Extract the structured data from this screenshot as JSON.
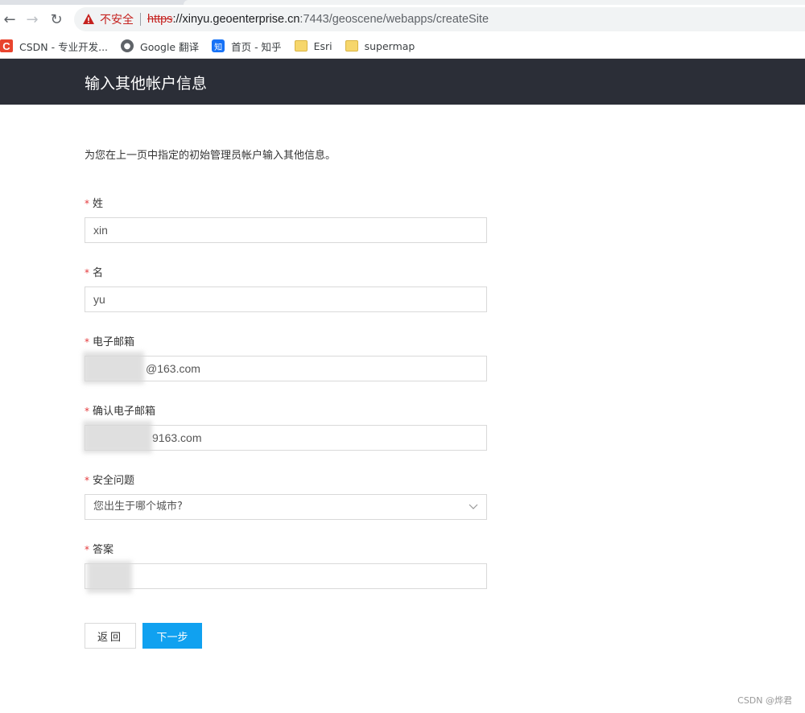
{
  "browser": {
    "insecure_label": "不安全",
    "url_scheme": "https",
    "url_host": "://xinyu.geoenterprise.cn",
    "url_rest": ":7443/geoscene/webapps/createSite",
    "bookmarks": [
      {
        "label": "CSDN - 专业开发...",
        "icon": "C"
      },
      {
        "label": "Google 翻译",
        "icon": "globe-icon"
      },
      {
        "label": "首页 - 知乎",
        "icon": "知"
      },
      {
        "label": "Esri",
        "icon": "folder-icon"
      },
      {
        "label": "supermap",
        "icon": "folder-icon"
      }
    ]
  },
  "header": {
    "title": "输入其他帐户信息"
  },
  "form": {
    "intro": "为您在上一页中指定的初始管理员帐户输入其他信息。",
    "required_mark": "*",
    "fields": [
      {
        "label": "姓",
        "value": "xin"
      },
      {
        "label": "名",
        "value": "yu"
      },
      {
        "label": "电子邮箱",
        "value": "@163.com"
      },
      {
        "label": "确认电子邮箱",
        "value": "9163.com"
      },
      {
        "label": "安全问题",
        "value": "您出生于哪个城市?"
      },
      {
        "label": "答案",
        "value": ""
      }
    ]
  },
  "buttons": {
    "back": "返回",
    "next": "下一步"
  },
  "watermark": "CSDN @烨君",
  "colors": {
    "header_bg": "#2b2e37",
    "primary": "#10a1f0",
    "required": "#e4393c"
  }
}
